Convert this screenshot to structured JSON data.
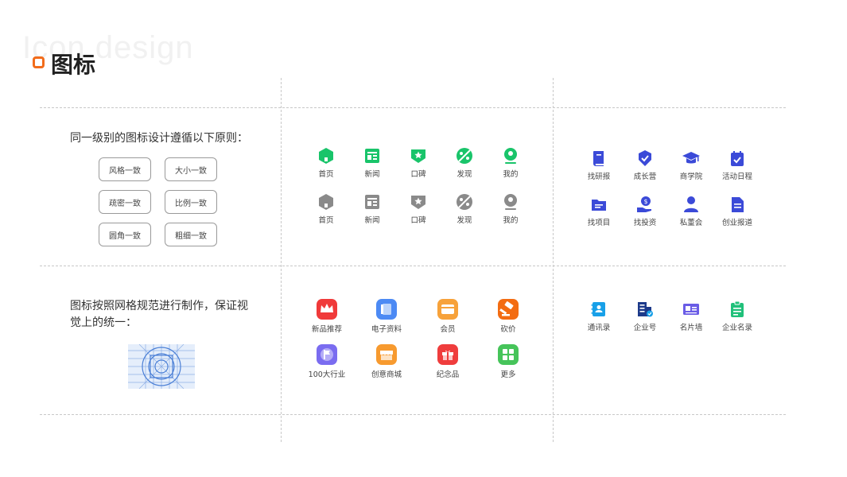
{
  "header": {
    "bg_text": "Icon design",
    "title": "图标"
  },
  "principles": {
    "consistency": "同一级别的图标设计遵循以下原则：",
    "grid_line1": "图标按照网格规范进行制作，保证视",
    "grid_line2": "觉上的统一："
  },
  "pills": [
    "风格一致",
    "大小一致",
    "疏密一致",
    "比例一致",
    "圆角一致",
    "粗细一致"
  ],
  "tab_icons_active": [
    {
      "label": "首页",
      "icon": "home-icon"
    },
    {
      "label": "新闻",
      "icon": "news-icon"
    },
    {
      "label": "口碑",
      "icon": "review-icon"
    },
    {
      "label": "发现",
      "icon": "discover-icon"
    },
    {
      "label": "我的",
      "icon": "profile-icon"
    }
  ],
  "tab_icons_inactive": [
    {
      "label": "首页",
      "icon": "home-icon"
    },
    {
      "label": "新闻",
      "icon": "news-icon"
    },
    {
      "label": "口碑",
      "icon": "review-icon"
    },
    {
      "label": "发现",
      "icon": "discover-icon"
    },
    {
      "label": "我的",
      "icon": "profile-icon"
    }
  ],
  "blue_icons_row1": [
    {
      "label": "找研报",
      "icon": "book-icon"
    },
    {
      "label": "成长营",
      "icon": "badge-icon"
    },
    {
      "label": "商学院",
      "icon": "graduation-cap-icon"
    },
    {
      "label": "活动日程",
      "icon": "calendar-check-icon"
    }
  ],
  "blue_icons_row2": [
    {
      "label": "找项目",
      "icon": "folder-icon"
    },
    {
      "label": "找投资",
      "icon": "money-hand-icon"
    },
    {
      "label": "私董会",
      "icon": "person-icon"
    },
    {
      "label": "创业报道",
      "icon": "document-icon"
    }
  ],
  "color_icons_row1": [
    {
      "label": "新品推荐",
      "icon": "crown-icon"
    },
    {
      "label": "电子资料",
      "icon": "ebook-icon"
    },
    {
      "label": "会员",
      "icon": "member-card-icon"
    },
    {
      "label": "砍价",
      "icon": "hammer-icon"
    }
  ],
  "color_icons_row2": [
    {
      "label": "100大行业",
      "icon": "flag-icon"
    },
    {
      "label": "创意商城",
      "icon": "store-icon"
    },
    {
      "label": "纪念品",
      "icon": "gift-icon"
    },
    {
      "label": "更多",
      "icon": "grid-icon"
    }
  ],
  "contact_icons": [
    {
      "label": "通讯录",
      "icon": "contacts-icon"
    },
    {
      "label": "企业号",
      "icon": "enterprise-icon"
    },
    {
      "label": "名片墙",
      "icon": "business-card-icon"
    },
    {
      "label": "企业名录",
      "icon": "clipboard-icon"
    }
  ],
  "colors": {
    "accent_orange": "#f26c1b",
    "tab_green": "#19c46a",
    "tab_gray": "#8a8a8a",
    "icon_blue": "#3b4ad8",
    "contact_purple": "#6a5ce6",
    "contact_green": "#20c07a",
    "contact_cyan": "#18a0e8"
  }
}
